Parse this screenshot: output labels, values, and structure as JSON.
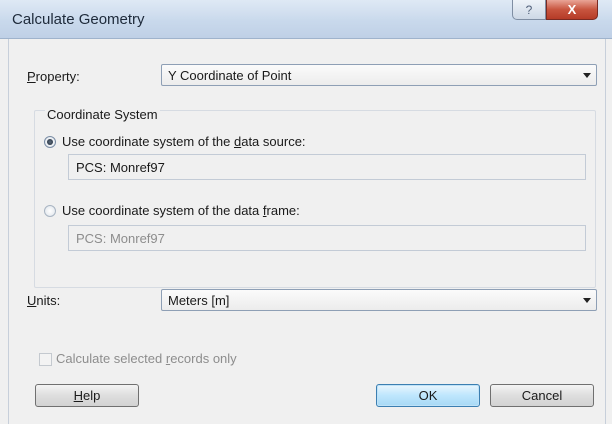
{
  "window": {
    "title": "Calculate Geometry",
    "help_glyph": "?",
    "close_glyph": "X"
  },
  "property": {
    "label_pre": "",
    "label_u": "P",
    "label_post": "roperty:",
    "value": "Y Coordinate of Point"
  },
  "coordinate_system": {
    "heading": "Coordinate System",
    "source_option": {
      "pre": "Use coordinate system of the ",
      "u": "d",
      "post": "ata source:",
      "selected": true,
      "value": "PCS: Monref97"
    },
    "frame_option": {
      "pre": "Use coordinate system of the data ",
      "u": "f",
      "post": "rame:",
      "selected": false,
      "value": "PCS: Monref97"
    }
  },
  "units": {
    "label_u": "U",
    "label_post": "nits:",
    "value": "Meters [m]"
  },
  "selected_only": {
    "pre": "Calculate selected ",
    "u": "r",
    "post": "ecords only",
    "checked": false
  },
  "buttons": {
    "help_u": "H",
    "help_post": "elp",
    "ok": "OK",
    "cancel": "Cancel"
  }
}
